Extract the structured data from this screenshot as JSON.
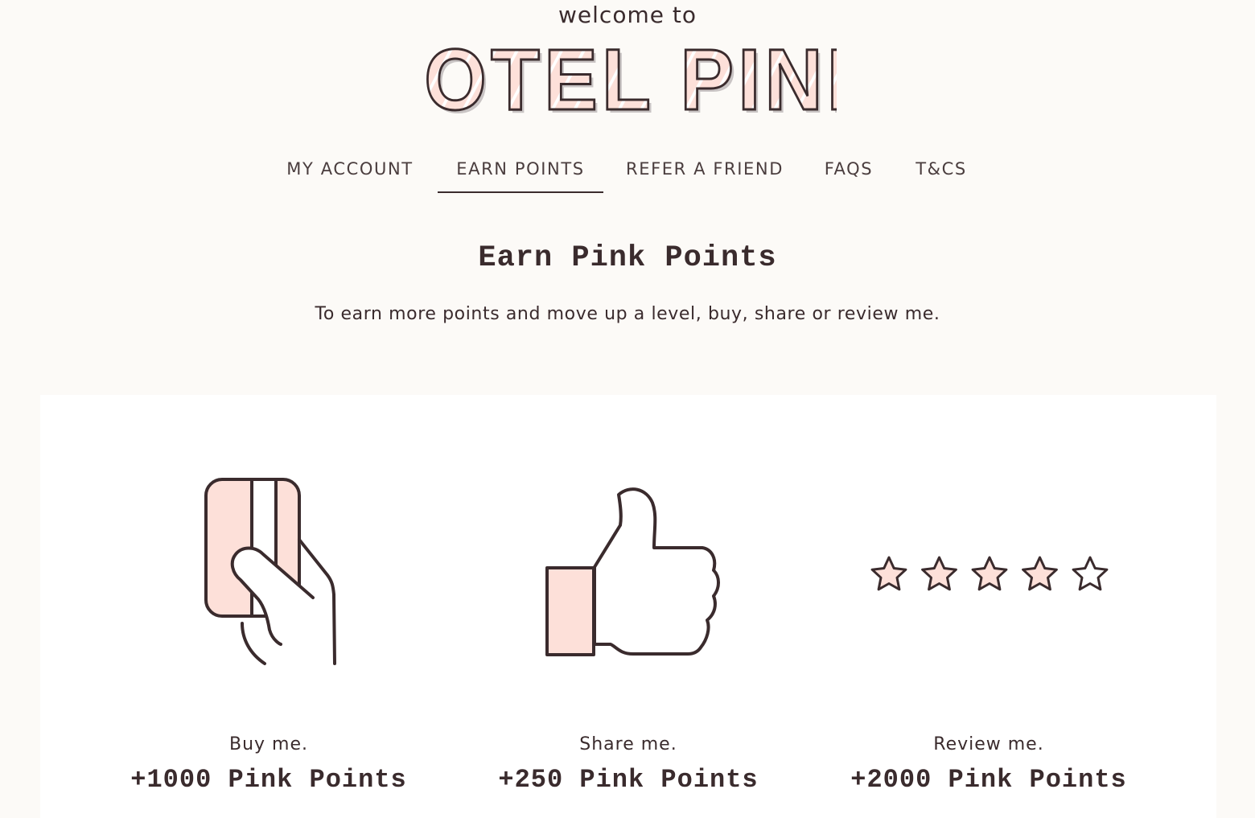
{
  "header": {
    "welcome": "welcome to",
    "brand": "HOTEL PINK"
  },
  "nav": {
    "items": [
      {
        "label": "MY ACCOUNT",
        "active": false
      },
      {
        "label": "EARN POINTS",
        "active": true
      },
      {
        "label": "REFER A FRIEND",
        "active": false
      },
      {
        "label": "FAQS",
        "active": false
      },
      {
        "label": "T&CS",
        "active": false
      }
    ]
  },
  "earn": {
    "title": "Earn Pink Points",
    "subtitle": "To earn more points and move up a level, buy, share or review me.",
    "tiles": [
      {
        "icon": "hand-holding-card-icon",
        "label": "Buy me.",
        "points": "+1000 Pink Points"
      },
      {
        "icon": "thumbs-up-icon",
        "label": "Share me.",
        "points": "+250 Pink Points"
      },
      {
        "icon": "star-rating-icon",
        "label": "Review me.",
        "points": "+2000 Pink Points"
      }
    ],
    "rating": {
      "filled": 4,
      "total": 5
    }
  },
  "colors": {
    "background": "#fcfaf7",
    "card": "#ffffff",
    "accent_pink": "#fde0d9",
    "ink": "#3a2b2d"
  }
}
